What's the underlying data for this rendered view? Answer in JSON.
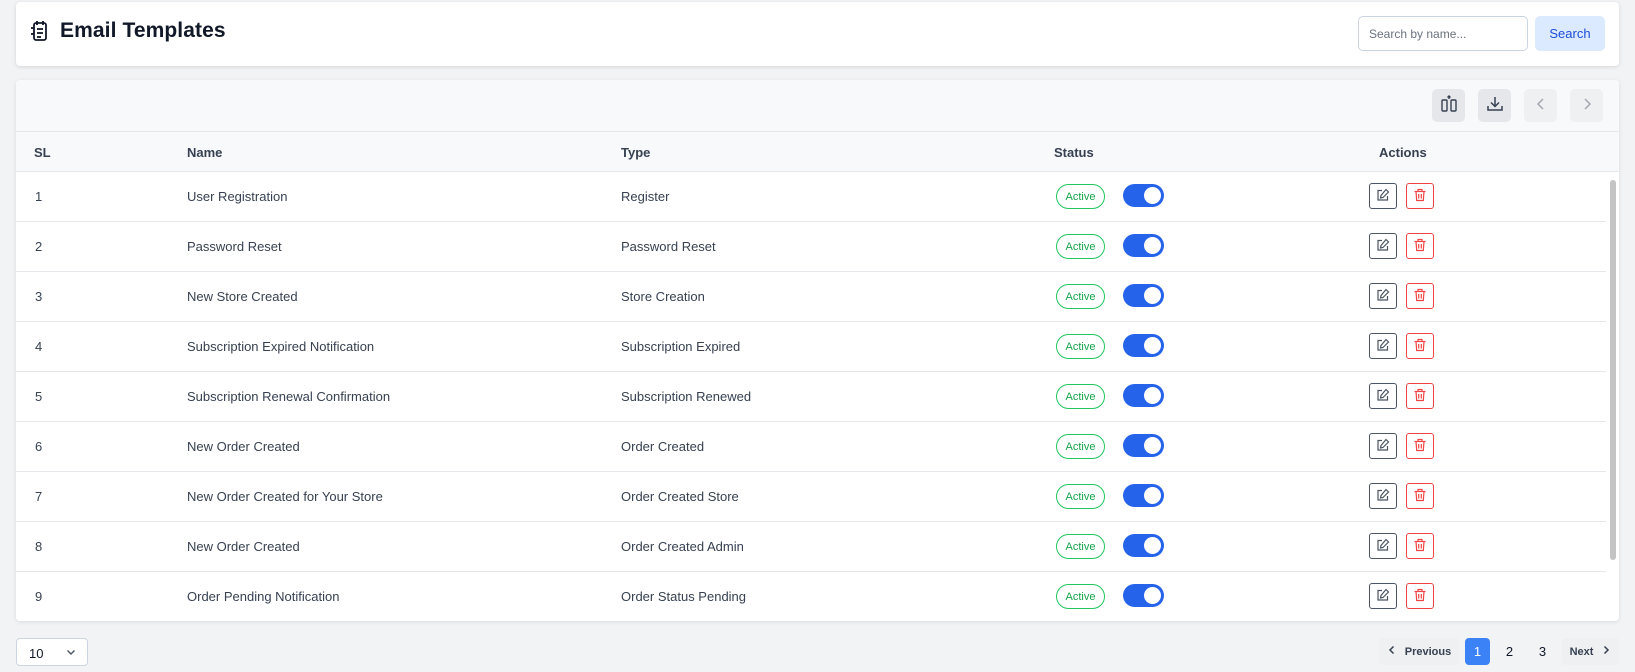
{
  "header": {
    "title": "Email Templates",
    "search_placeholder": "Search by name...",
    "search_label": "Search"
  },
  "table": {
    "columns": [
      "SL",
      "Name",
      "Type",
      "Status",
      "Actions"
    ],
    "rows": [
      {
        "sl": "1",
        "name": "User Registration",
        "type": "Register",
        "status": "Active",
        "enabled": true
      },
      {
        "sl": "2",
        "name": "Password Reset",
        "type": "Password Reset",
        "status": "Active",
        "enabled": true
      },
      {
        "sl": "3",
        "name": "New Store Created",
        "type": "Store Creation",
        "status": "Active",
        "enabled": true
      },
      {
        "sl": "4",
        "name": "Subscription Expired Notification",
        "type": "Subscription Expired",
        "status": "Active",
        "enabled": true
      },
      {
        "sl": "5",
        "name": "Subscription Renewal Confirmation",
        "type": "Subscription Renewed",
        "status": "Active",
        "enabled": true
      },
      {
        "sl": "6",
        "name": "New Order Created",
        "type": "Order Created",
        "status": "Active",
        "enabled": true
      },
      {
        "sl": "7",
        "name": "New Order Created for Your Store",
        "type": "Order Created Store",
        "status": "Active",
        "enabled": true
      },
      {
        "sl": "8",
        "name": "New Order Created",
        "type": "Order Created Admin",
        "status": "Active",
        "enabled": true
      },
      {
        "sl": "9",
        "name": "Order Pending Notification",
        "type": "Order Status Pending",
        "status": "Active",
        "enabled": true
      }
    ]
  },
  "footer": {
    "per_page": "10",
    "previous_label": "Previous",
    "next_label": "Next",
    "pages": [
      "1",
      "2",
      "3"
    ],
    "current_page": "1"
  },
  "colors": {
    "accent": "#2563eb",
    "active_badge": "#16a34a",
    "delete": "#ef4444"
  },
  "icons": {
    "title": "template-icon",
    "toolbar": [
      "columns-icon",
      "download-icon",
      "chevron-left-icon",
      "chevron-right-icon"
    ],
    "row_actions": [
      "edit-icon",
      "trash-icon"
    ]
  }
}
